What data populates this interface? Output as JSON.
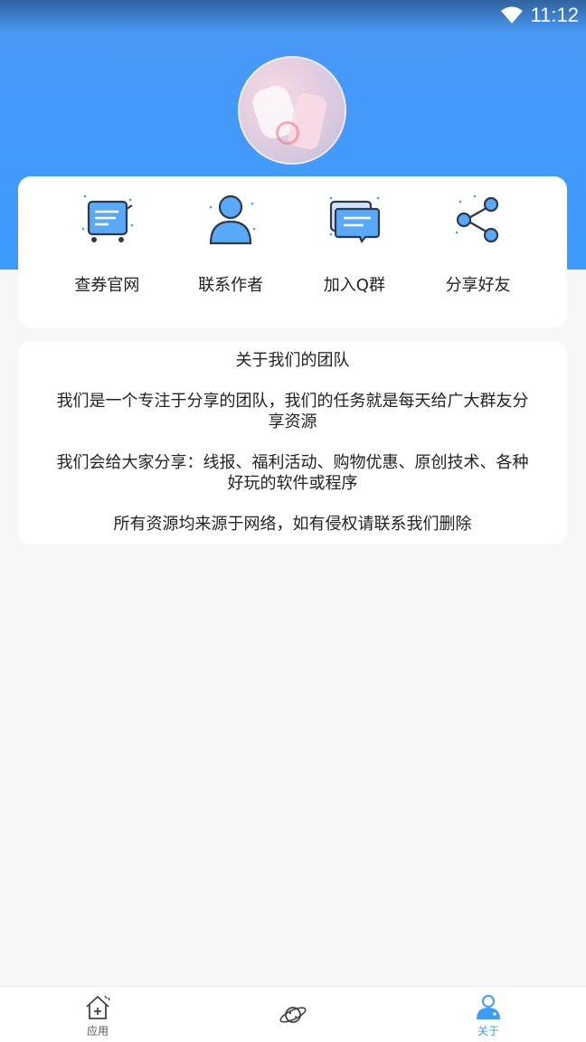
{
  "status_bar": {
    "time": "11:12"
  },
  "menu": [
    {
      "label": "查券官网",
      "icon": "cart-icon"
    },
    {
      "label": "联系作者",
      "icon": "user-icon"
    },
    {
      "label": "加入Q群",
      "icon": "chat-icon"
    },
    {
      "label": "分享好友",
      "icon": "share-icon"
    }
  ],
  "about": {
    "title": "关于我们的团队",
    "paragraph1": "我们是一个专注于分享的团队，我们的任务就是每天给广大群友分享资源",
    "paragraph2": "我们会给大家分享：线报、福利活动、购物优惠、原创技术、各种好玩的软件或程序",
    "paragraph3": "所有资源均来源于网络，如有侵权请联系我们删除"
  },
  "bottom_nav": {
    "items": [
      {
        "label": "应用",
        "icon": "home-icon",
        "active": false
      },
      {
        "label": "",
        "icon": "planet-icon",
        "active": false
      },
      {
        "label": "关于",
        "icon": "profile-icon",
        "active": true
      }
    ]
  },
  "colors": {
    "primary": "#3f9cf6",
    "background": "#f7f7f7",
    "card": "#ffffff"
  }
}
